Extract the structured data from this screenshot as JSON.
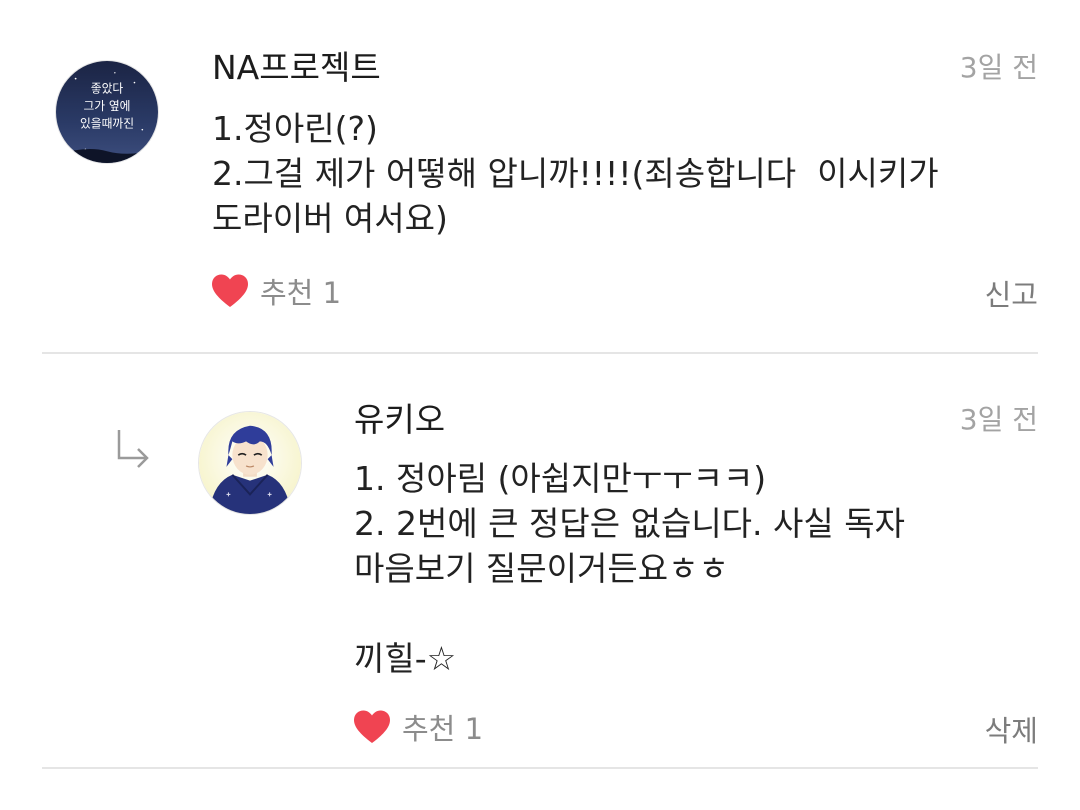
{
  "comments": [
    {
      "author": "NA프로젝트",
      "time": "3일 전",
      "lines": [
        "1.정아린(?)",
        "2.그걸 제가 어떻해 압니까!!!!(죄송합니다  이시키가",
        "도라이버 여서요)"
      ],
      "like_label": "추천 1",
      "action": "신고",
      "avatar_text": [
        "좋았다",
        "그가 옆에",
        "있을때까진"
      ]
    },
    {
      "author": "유키오",
      "time": "3일 전",
      "lines": [
        "1. 정아림 (아쉽지만ㅜㅜㅋㅋ)",
        "2. 2번에 큰 정답은 없습니다. 사실 독자",
        "마음보기 질문이거든요ㅎㅎ",
        "",
        "끼힐-☆"
      ],
      "like_label": "추천 1",
      "action": "삭제"
    }
  ],
  "colors": {
    "heart": "#f04452",
    "divider": "#e5e5e5",
    "muted": "#a3a3a3"
  },
  "icons": {
    "like": "heart-icon",
    "reply": "reply-arrow-icon"
  }
}
